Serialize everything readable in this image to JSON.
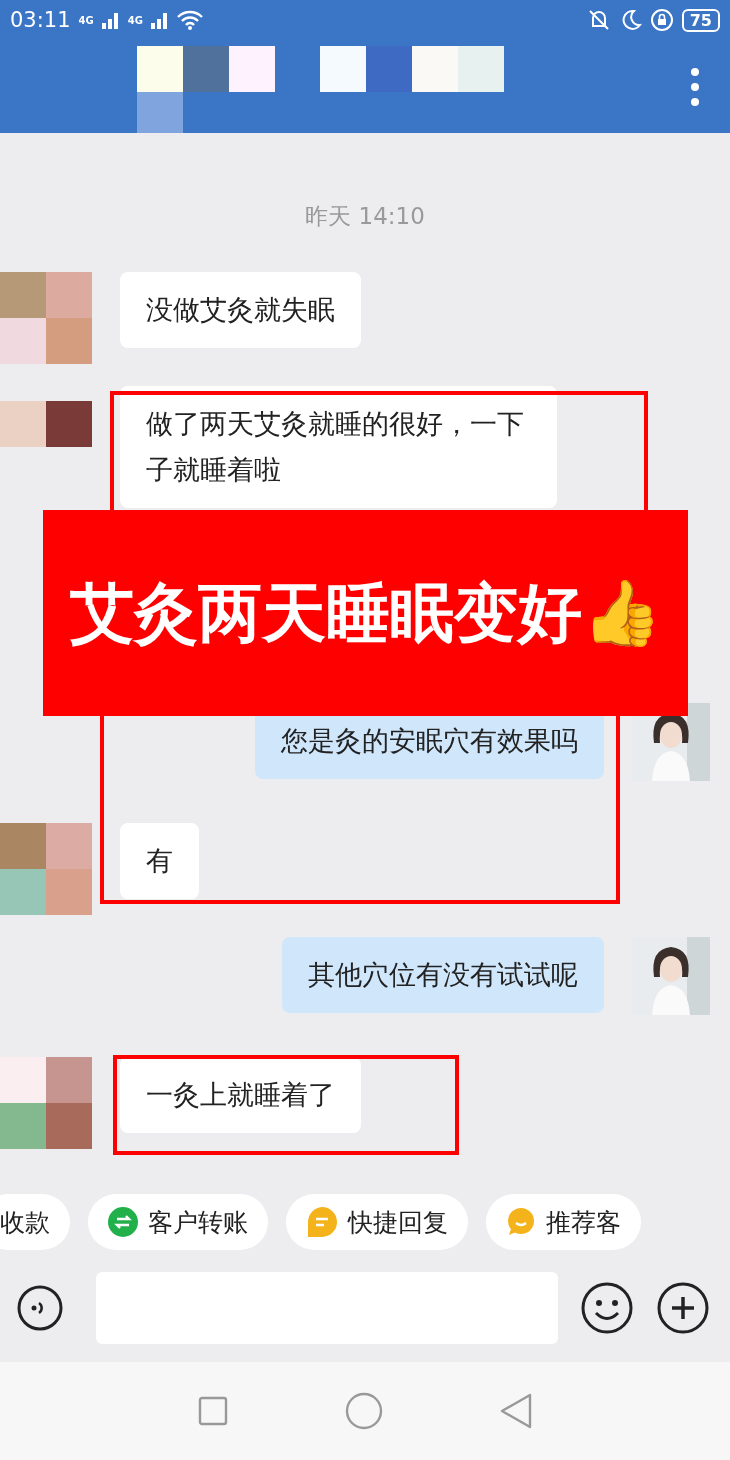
{
  "status_bar": {
    "time": "03:11",
    "network_1": "4G",
    "network_2": "4G",
    "battery": "75"
  },
  "chat": {
    "timestamp": "昨天  14:10",
    "messages": [
      {
        "kind": "incoming",
        "text": "没做艾灸就失眠"
      },
      {
        "kind": "incoming",
        "text": "做了两天艾灸就睡的很好，一下子就睡着啦"
      },
      {
        "kind": "outgoing",
        "text": "您是灸的安眠穴有效果吗"
      },
      {
        "kind": "incoming",
        "text": "有"
      },
      {
        "kind": "outgoing",
        "text": "其他穴位有没有试试呢"
      },
      {
        "kind": "incoming",
        "text": "一灸上就睡着了"
      }
    ]
  },
  "banner": {
    "text": "艾灸两天睡眠变好👍"
  },
  "quick_actions": [
    {
      "kind": "plain",
      "label": "收款"
    },
    {
      "kind": "transfer",
      "label": "客户转账"
    },
    {
      "kind": "reply",
      "label": "快捷回复"
    },
    {
      "kind": "recommend",
      "label": "推荐客"
    }
  ]
}
